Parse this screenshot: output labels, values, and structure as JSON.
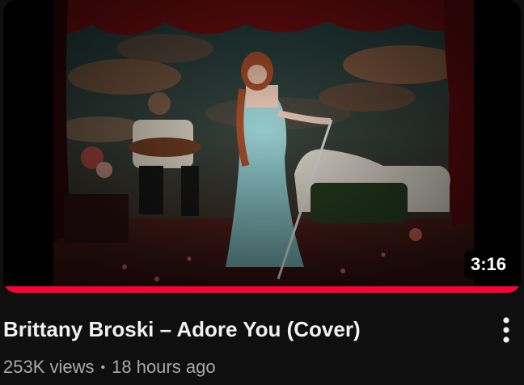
{
  "video": {
    "title": "Brittany Broski – Adore You (Cover)",
    "duration": "3:16",
    "watch_progress": 1.0,
    "views": "253K views",
    "separator": "•",
    "published": "18 hours ago"
  },
  "icons": {
    "more": "more-vertical-icon"
  },
  "colors": {
    "progress": "#ff0033",
    "title": "#f1f1f1",
    "meta": "#aaaaaa",
    "background": "#0f0f0f"
  }
}
